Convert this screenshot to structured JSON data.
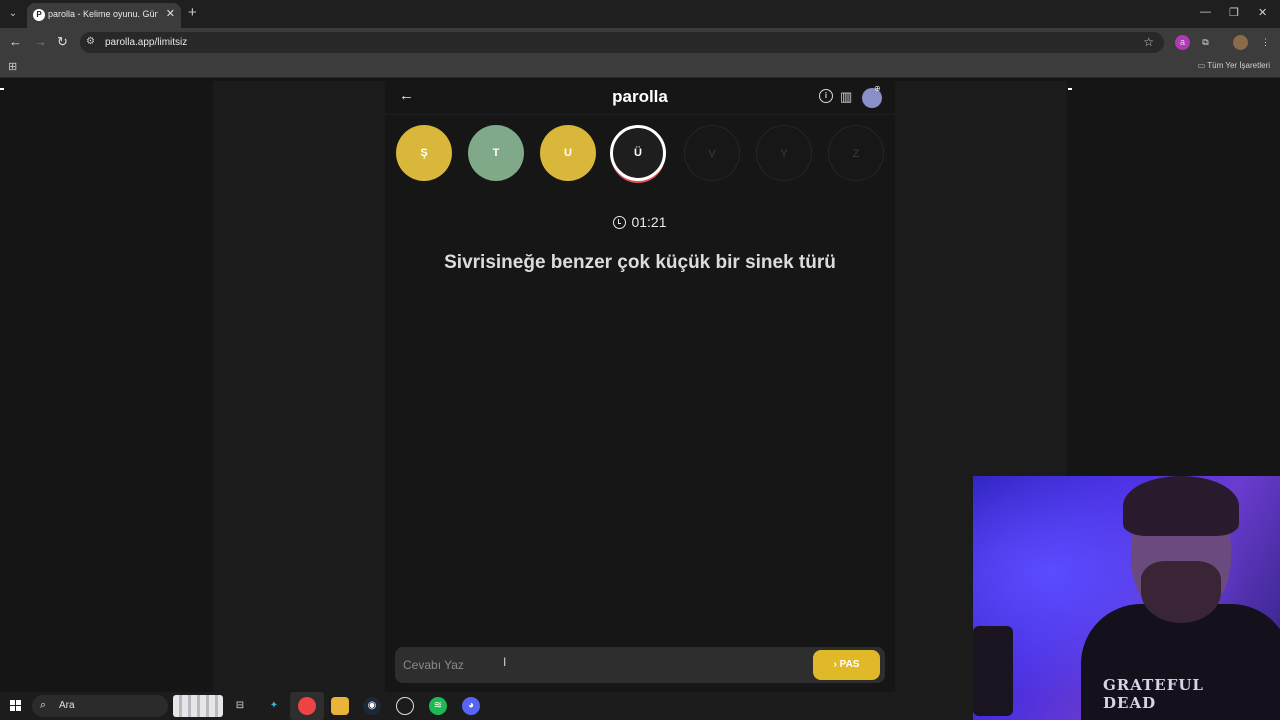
{
  "browser": {
    "tab_title": "parolla - Kelime oyunu. Günlük",
    "url": "parolla.app/limitsiz",
    "bookmarks_label": "Tüm Yer İşaretleri"
  },
  "app": {
    "logo": "parolla",
    "letters": [
      {
        "letter": "Ş",
        "state": "yellow"
      },
      {
        "letter": "T",
        "state": "green"
      },
      {
        "letter": "U",
        "state": "yellow"
      },
      {
        "letter": "Ü",
        "state": "current"
      },
      {
        "letter": "V",
        "state": "pending"
      },
      {
        "letter": "Y",
        "state": "pending"
      },
      {
        "letter": "Z",
        "state": "pending"
      }
    ],
    "timer": "01:21",
    "question": "Sivrisineğe benzer çok küçük bir sinek türü",
    "answer_placeholder": "Cevabı Yaz",
    "pass_label": "PAS"
  },
  "taskbar": {
    "search_label": "Ara"
  },
  "webcam": {
    "shirt_text": "GRATEFUL DEAD"
  },
  "colors": {
    "yellow": "#d8b73a",
    "green": "#7fa988",
    "pass_button": "#e0b928",
    "current_ring": "#e0535c"
  }
}
